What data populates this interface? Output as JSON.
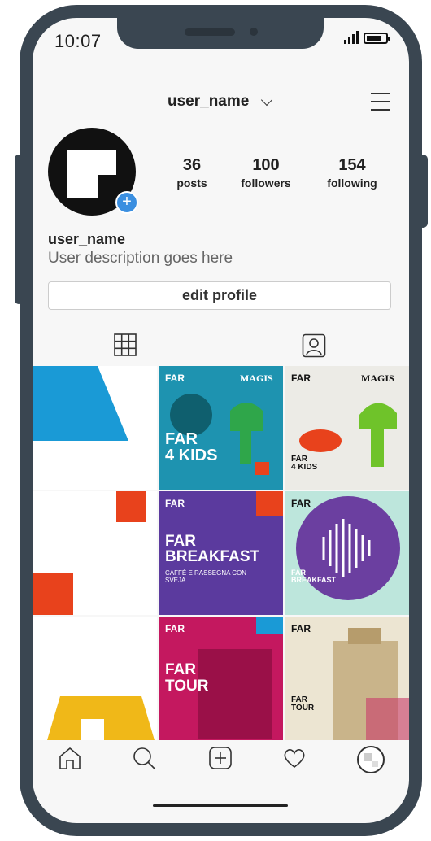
{
  "status_bar": {
    "time": "10:07"
  },
  "header": {
    "username": "user_name"
  },
  "profile": {
    "stats": [
      {
        "value": "36",
        "label": "posts"
      },
      {
        "value": "100",
        "label": "followers"
      },
      {
        "value": "154",
        "label": "following"
      }
    ],
    "name": "user_name",
    "description": "User description goes here",
    "edit_label": "edit profile"
  },
  "tabs": [
    {
      "name": "grid-icon"
    },
    {
      "name": "tagged-icon"
    }
  ],
  "posts": [
    {
      "brand": "",
      "title": "",
      "subtitle": ""
    },
    {
      "brand": "FAR",
      "partner": "MAGIS",
      "title": "FAR\n4 KIDS",
      "subtitle": ""
    },
    {
      "brand": "FAR",
      "partner": "MAGIS",
      "title": "FAR\n4 KIDS",
      "subtitle": ""
    },
    {
      "brand": "",
      "title": "",
      "subtitle": ""
    },
    {
      "brand": "FAR",
      "title": "FAR\nBREAKFAST",
      "subtitle": "CAFFÈ E RASSEGNA CON SVEJA"
    },
    {
      "brand": "FAR",
      "title": "FAR\nBREAKFAST",
      "subtitle": ""
    },
    {
      "brand": "",
      "title": "",
      "subtitle": ""
    },
    {
      "brand": "FAR",
      "title": "FAR\nTOUR",
      "subtitle": ""
    },
    {
      "brand": "FAR",
      "title": "FAR\nTOUR",
      "subtitle": ""
    }
  ],
  "bottom_nav": [
    {
      "name": "home-icon"
    },
    {
      "name": "search-icon"
    },
    {
      "name": "new-post-icon"
    },
    {
      "name": "activity-icon"
    },
    {
      "name": "profile-icon"
    }
  ],
  "colors": {
    "frame": "#3a4651",
    "accent_blue": "#3b8fe0",
    "far_blue": "#1a9ad6",
    "far_red": "#e8421c",
    "far_purple": "#6b3fa0",
    "far_magenta": "#d6186e",
    "far_yellow": "#f0b818",
    "far_green": "#2fa64a"
  }
}
